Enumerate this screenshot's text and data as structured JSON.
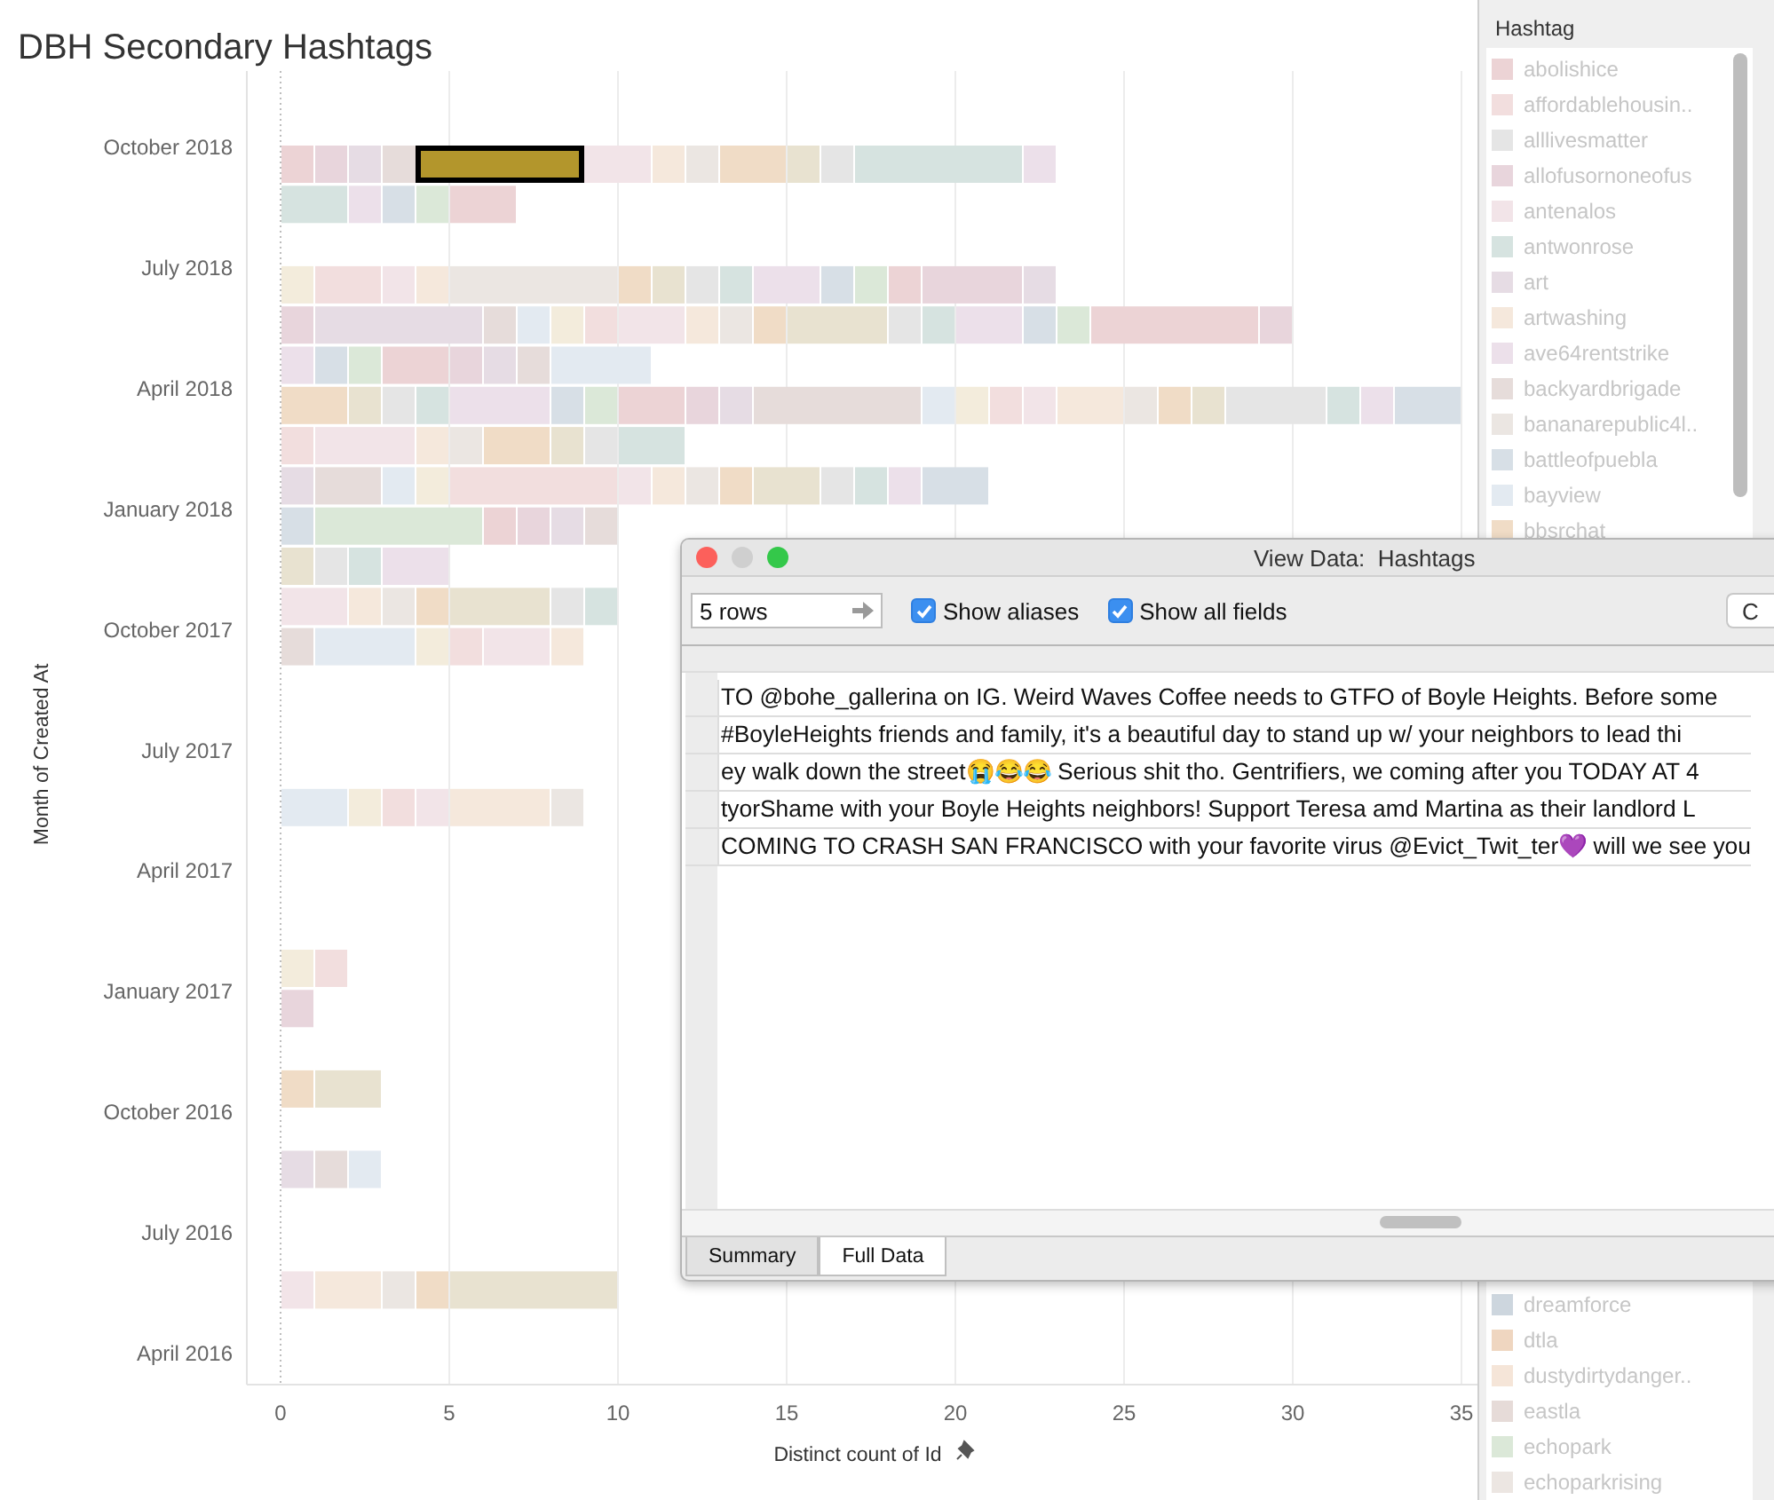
{
  "title": "DBH Secondary Hashtags",
  "chart": {
    "x_title": "Distinct count of Id",
    "y_title": "Month of Created At",
    "x_labels": [
      "0",
      "5",
      "10",
      "15",
      "20",
      "25",
      "30",
      "35"
    ],
    "y_labels": [
      "October 2018",
      "July 2018",
      "April 2018",
      "January 2018",
      "October 2017",
      "July 2017",
      "April 2017",
      "January 2017",
      "October 2016",
      "July 2016",
      "April 2016"
    ]
  },
  "legend": {
    "title": "Hashtag",
    "items": [
      {
        "label": "abolishice",
        "color": "#ecd3d5"
      },
      {
        "label": "affordablehousin..",
        "color": "#f2dede"
      },
      {
        "label": "alllivesmatter",
        "color": "#e5e5e5"
      },
      {
        "label": "allofusornoneofus",
        "color": "#e8d5dc"
      },
      {
        "label": "antenalos",
        "color": "#f2e4e8"
      },
      {
        "label": "antwonrose",
        "color": "#d6e3e0"
      },
      {
        "label": "art",
        "color": "#e6dce4"
      },
      {
        "label": "artwashing",
        "color": "#f5e8dc"
      },
      {
        "label": "ave64rentstrike",
        "color": "#ece0ea"
      },
      {
        "label": "backyardbrigade",
        "color": "#e6dcda"
      },
      {
        "label": "bananarepublic4l..",
        "color": "#ebe6e2"
      },
      {
        "label": "battleofpuebla",
        "color": "#d7dfe6"
      },
      {
        "label": "bayview",
        "color": "#e3eaf1"
      },
      {
        "label": "bbsrchat",
        "color": "#f0dcc6"
      }
    ],
    "items_below": [
      {
        "label": "dreamforce",
        "color": "#cdd6de"
      },
      {
        "label": "dtla",
        "color": "#efd6c0"
      },
      {
        "label": "dustydirtydanger..",
        "color": "#f5e5d8"
      },
      {
        "label": "eastla",
        "color": "#e6dbd8"
      },
      {
        "label": "echopark",
        "color": "#dbe8d8"
      },
      {
        "label": "echoparkrising",
        "color": "#ece6e2"
      }
    ]
  },
  "dialog": {
    "title": "View Data:  Hashtags",
    "rows_field": {
      "value": "5 rows"
    },
    "checkboxes": [
      {
        "label": "Show aliases",
        "checked": true
      },
      {
        "label": "Show all fields",
        "checked": true
      }
    ],
    "button": "C",
    "rows": [
      "TO @bohe_gallerina on IG.   Weird Waves Coffee needs to GTFO of Boyle Heights. Before some",
      "#BoyleHeights friends and family, it's a beautiful day to stand up w/ your neighbors to lead thi",
      "ey walk down the street😭😂😂 Serious shit tho. Gentrifiers, we coming after you TODAY AT 4",
      "tyorShame with your Boyle Heights neighbors! Support Teresa amd Martina as their landlord L",
      "COMING TO CRASH SAN FRANCISCO with your favorite virus @Evict_Twit_ter💜 will we see you"
    ],
    "tabs": [
      {
        "label": "Summary",
        "selected": false
      },
      {
        "label": "Full Data",
        "selected": true
      }
    ]
  }
}
